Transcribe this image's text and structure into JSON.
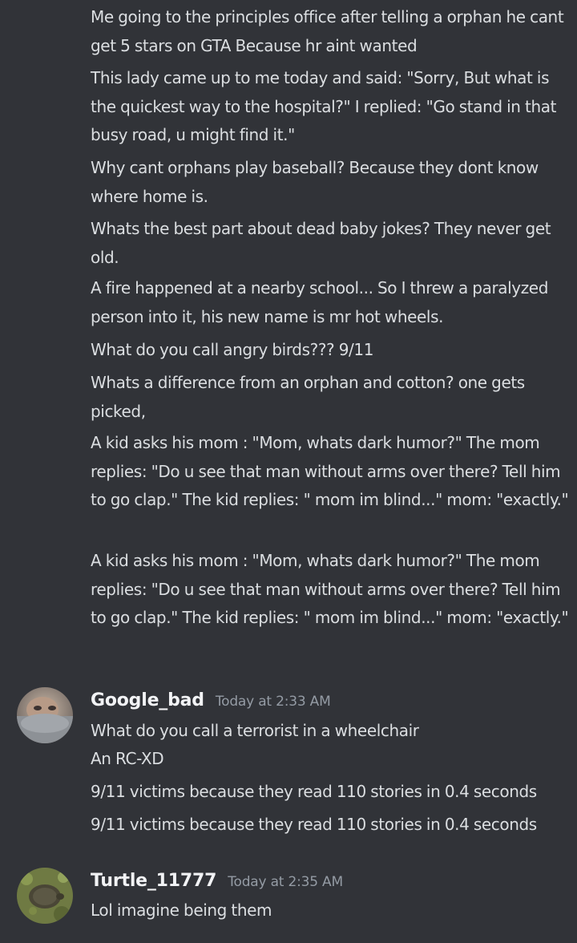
{
  "messages_continued": [
    "Me going to the principles office after telling a orphan he cant get 5 stars on GTA Because hr aint wanted",
    "This lady came up to me today and said: \"Sorry, But what is the quickest way to the hospital?\" I replied: \"Go stand in that busy road, u might find it.\"",
    "Why cant orphans play baseball? Because they dont know where home is.",
    "Whats the best part about dead baby jokes? They never get old.",
    "A fire happened at a nearby school... So I threw a paralyzed person into it, his new name is mr hot wheels.",
    "What do you call angry birds??? 9/11",
    "Whats a difference from an orphan and cotton? one gets picked,",
    "A kid asks his mom : \"Mom, whats dark humor?\" The mom replies: \"Do u see that man without arms over there? Tell him to go clap.\" The kid replies: \" mom im blind...\" mom: \"exactly.\"",
    "A kid asks his mom : \"Mom, whats dark humor?\" The mom replies: \"Do u see that man without arms over there? Tell him to go clap.\" The kid replies: \" mom im blind...\" mom: \"exactly.\""
  ],
  "google_bad": {
    "username": "Google_bad",
    "timestamp": "Today at 2:33 AM",
    "line1": "What do you call a terrorist in a wheelchair",
    "line2": "An RC-XD",
    "line3": "9/11 victims because they read 110 stories in 0.4 seconds",
    "line4": "9/11 victims because they read 110 stories in 0.4 seconds"
  },
  "turtle": {
    "username": "Turtle_11777",
    "timestamp": "Today at 2:35 AM",
    "line1": "Lol imagine being them"
  }
}
